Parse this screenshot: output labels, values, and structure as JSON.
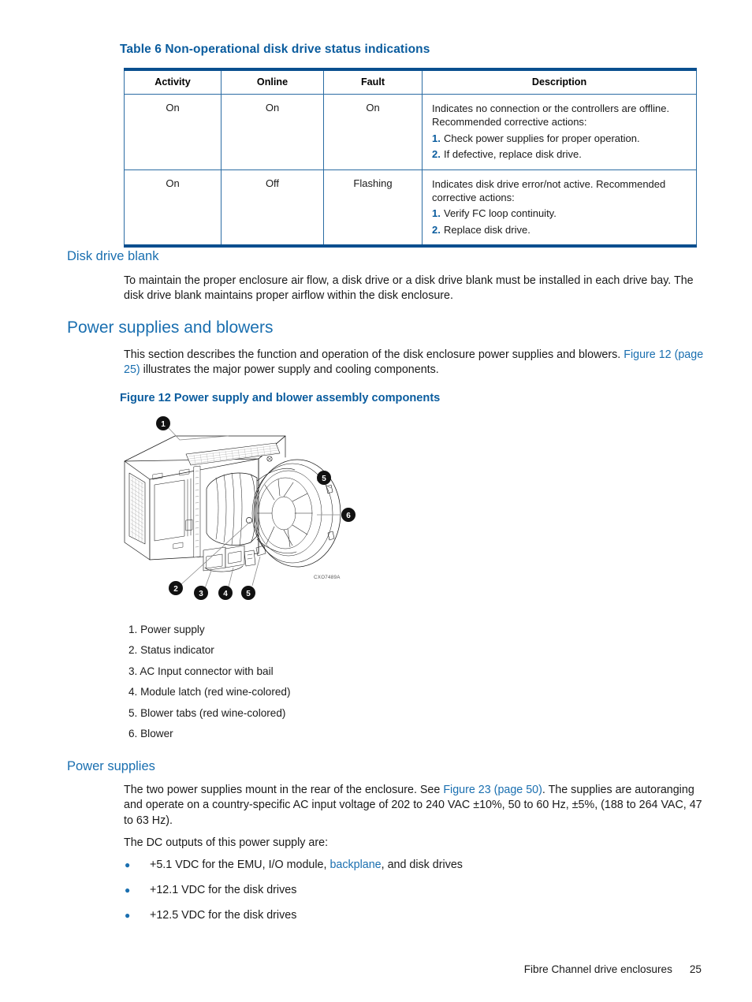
{
  "table": {
    "title": "Table 6 Non-operational disk drive status indications",
    "columns": [
      "Activity",
      "Online",
      "Fault",
      "Description"
    ],
    "rows": [
      {
        "activity": "On",
        "online": "On",
        "fault": "On",
        "description_lead": "Indicates no connection or the controllers are offline. Recommended corrective actions:",
        "steps": [
          {
            "num": "1.",
            "text": "Check power supplies for proper operation."
          },
          {
            "num": "2.",
            "text": "If defective, replace disk drive."
          }
        ]
      },
      {
        "activity": "On",
        "online": "Off",
        "fault": "Flashing",
        "description_lead": "Indicates disk drive error/not active. Recommended corrective actions:",
        "steps": [
          {
            "num": "1.",
            "text": "Verify FC loop continuity."
          },
          {
            "num": "2.",
            "text": "Replace disk drive."
          }
        ]
      }
    ]
  },
  "sections": {
    "disk_drive_blank": {
      "heading": "Disk drive blank",
      "paragraph": "To maintain the proper enclosure air flow, a disk drive or a disk drive blank must be installed in each drive bay. The disk drive blank maintains proper airflow within the disk enclosure."
    },
    "power_supplies_and_blowers": {
      "heading": "Power supplies and blowers",
      "paragraph_part1": "This section describes the function and operation of the disk enclosure power supplies and blowers.",
      "paragraph_link": "Figure 12 (page 25)",
      "paragraph_part2": " illustrates the major power supply and cooling components."
    },
    "power_supplies": {
      "heading": "Power supplies",
      "paragraph_part1": "The two power supplies mount in the rear of the enclosure. See ",
      "paragraph_link": "Figure 23 (page 50)",
      "paragraph_part2": ". The supplies are autoranging and operate on a country-specific AC input voltage of 202 to 240 VAC ±10%, 50 to 60 Hz, ±5%, (188 to 264 VAC, 47 to 63 Hz).",
      "dc_intro": "The DC outputs of this power supply are:",
      "bullets": [
        {
          "before": "+5.1 VDC for the EMU, I/O module, ",
          "link": "backplane",
          "after": ", and disk drives"
        },
        {
          "before": "+12.1 VDC for the disk drives",
          "link": "",
          "after": ""
        },
        {
          "before": "+12.5 VDC for the disk drives",
          "link": "",
          "after": ""
        }
      ]
    }
  },
  "figure": {
    "caption": "Figure 12 Power supply and blower assembly components",
    "image_id": "CXO7489A",
    "callouts": [
      "1",
      "2",
      "3",
      "4",
      "5",
      "5",
      "6"
    ],
    "legend": [
      "1. Power supply",
      "2. Status indicator",
      "3. AC Input connector with bail",
      "4. Module latch (red wine-colored)",
      "5. Blower tabs (red wine-colored)",
      "6. Blower"
    ]
  },
  "footer": {
    "chapter": "Fibre Channel drive enclosures",
    "page_number": "25"
  },
  "colors": {
    "heading_blue": "#1a6fb0",
    "title_blue": "#0a5c9e",
    "rule_blue": "#0a4f8f",
    "grid_blue": "#2b6ca3"
  }
}
